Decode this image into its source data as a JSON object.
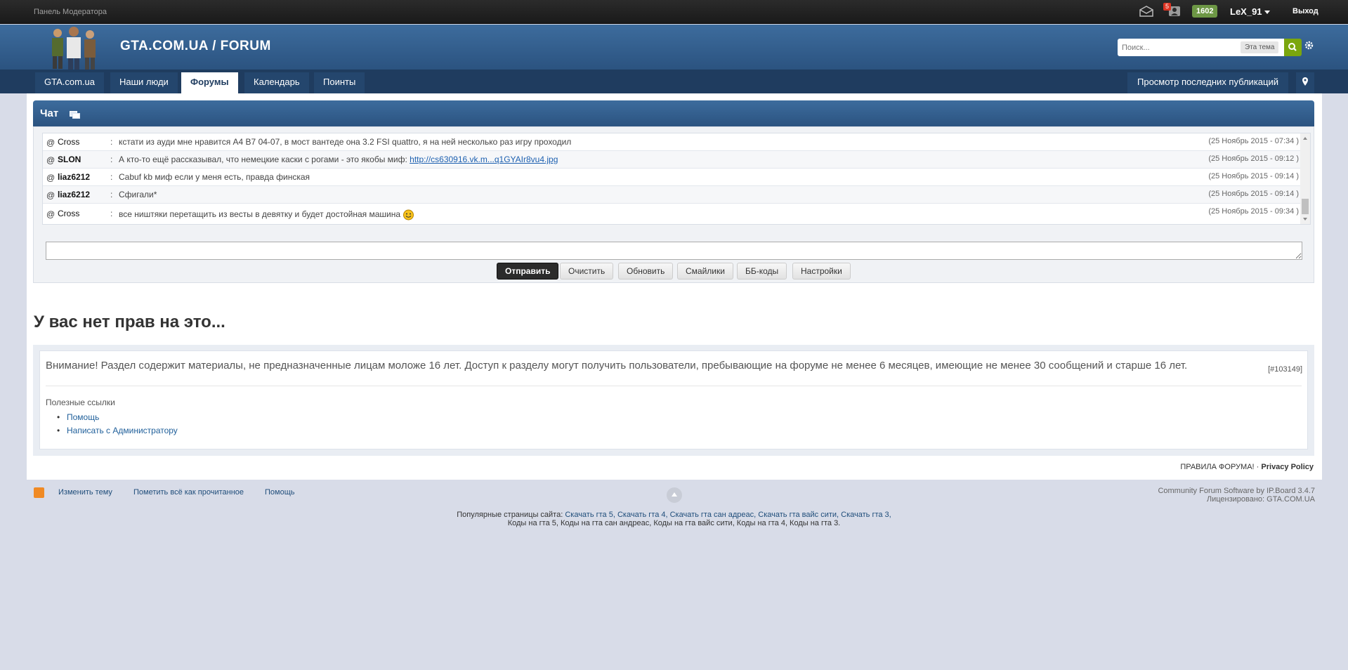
{
  "topbar": {
    "mod_panel": "Панель Модератора",
    "notif_count": "5",
    "points": "1602",
    "username": "LeX_91",
    "logout": "Выход"
  },
  "header": {
    "title": "GTA.COM.UA / FORUM",
    "search_placeholder": "Поиск...",
    "search_scope": "Эта тема"
  },
  "nav": {
    "tabs": [
      "GTA.com.ua",
      "Наши люди",
      "Форумы",
      "Календарь",
      "Поинты"
    ],
    "active": "Форумы",
    "recent": "Просмотр последних публикаций"
  },
  "chat": {
    "title": "Чат",
    "messages": [
      {
        "at": "@",
        "nick": "Cross",
        "sep": ":",
        "text": "кстати из ауди мне нравится А4 В7 04-07, в мост вантеде она 3.2 FSI quattro, я на ней несколько раз игру проходил",
        "time": "(25 Ноябрь 2015 - 07:34 )"
      },
      {
        "at": "@",
        "nick": "SLON",
        "sep": ":",
        "text": "А кто-то ещё рассказывал, что немецкие каски с рогами - это якобы миф: ",
        "link": "http://cs630916.vk.m...q1GYAIr8vu4.jpg",
        "time": "(25 Ноябрь 2015 - 09:12 )"
      },
      {
        "at": "@",
        "nick": "liaz6212",
        "sep": ":",
        "text": "Cabuf kb миф если у меня есть, правда финская",
        "time": "(25 Ноябрь 2015 - 09:14 )"
      },
      {
        "at": "@",
        "nick": "liaz6212",
        "sep": ":",
        "text": "Сфигали*",
        "time": "(25 Ноябрь 2015 - 09:14 )"
      },
      {
        "at": "@",
        "nick": "Cross",
        "sep": ":",
        "text": "все ништяки перетащить из весты в девятку и будет достойная машина",
        "time": "(25 Ноябрь 2015 - 09:34 )"
      }
    ],
    "buttons": [
      "Отправить",
      "Очистить",
      "Обновить",
      "Смайлики",
      "ББ-коды",
      "Настройки"
    ]
  },
  "main": {
    "no_rights": "У вас нет прав на это...",
    "warning": "Внимание! Раздел содержит материалы, не предназначенные лицам моложе 16 лет. Доступ к разделу могут получить пользователи, пребывающие на форуме не менее 6 месяцев, имеющие не менее 30 сообщений и старше 16 лет.",
    "code": "[#103149]",
    "useful": "Полезные ссылки",
    "links": [
      "Помощь",
      "Написать с Администратору"
    ],
    "rules": "ПРАВИЛА ФОРУМА!",
    "dot": "·",
    "privacy": "Privacy Policy"
  },
  "footer": {
    "links": [
      "Изменить тему",
      "Пометить всё как прочитанное",
      "Помощь"
    ],
    "copyright1": "Community Forum Software by IP.Board 3.4.7",
    "copyright2": "Лицензировано: GTA.COM.UA",
    "popular_label": "Популярные страницы сайта:",
    "popular_line1": "Скачать гта 5, Скачать гта 4, Скачать гта сан адреас, Скачать гта вайс сити, Скачать гта 3,",
    "popular_line2": "Коды на гта 5, Коды на гта сан андреас, Коды на гта вайс сити, Коды на гта 4, Коды на гта 3."
  }
}
